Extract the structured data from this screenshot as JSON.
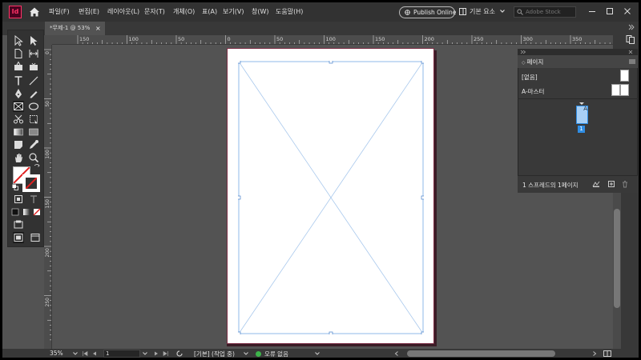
{
  "app": {
    "logo_text": "Id"
  },
  "menu": {
    "items": [
      "파일(F)",
      "편집(E)",
      "레이아웃(L)",
      "문자(T)",
      "개체(O)",
      "표(A)",
      "보기(V)",
      "창(W)",
      "도움말(H)"
    ]
  },
  "header": {
    "publish_label": "Publish Online",
    "workspace_label": "기본 요소",
    "stock_search_placeholder": "Adobe Stock"
  },
  "document": {
    "tab_title": "*무제-1 @ 53%",
    "close_glyph": "×"
  },
  "rulers": {
    "horizontal_labels": [
      "150",
      "100",
      "50",
      "0",
      "50",
      "100",
      "150",
      "200",
      "250",
      "300",
      "350"
    ],
    "vertical_labels": [
      "0",
      "50",
      "100",
      "150",
      "200",
      "250"
    ]
  },
  "pages_panel": {
    "tab_label": "페이지",
    "none_label": "[없음]",
    "master_label": "A-마스터",
    "page_master_letter": "A",
    "page_number": "1",
    "status_text": "1 스프레드의 1페이지"
  },
  "statusbar": {
    "zoom": "35%",
    "page_number": "1",
    "profile": "[기본] (작업 중)",
    "preflight": "오류 없음"
  },
  "colors": {
    "accent_logo": "#ff3366",
    "selection_blue": "#2f8de4",
    "frame_line": "#8fb8e8",
    "preflight_ok": "#3cb54a"
  }
}
